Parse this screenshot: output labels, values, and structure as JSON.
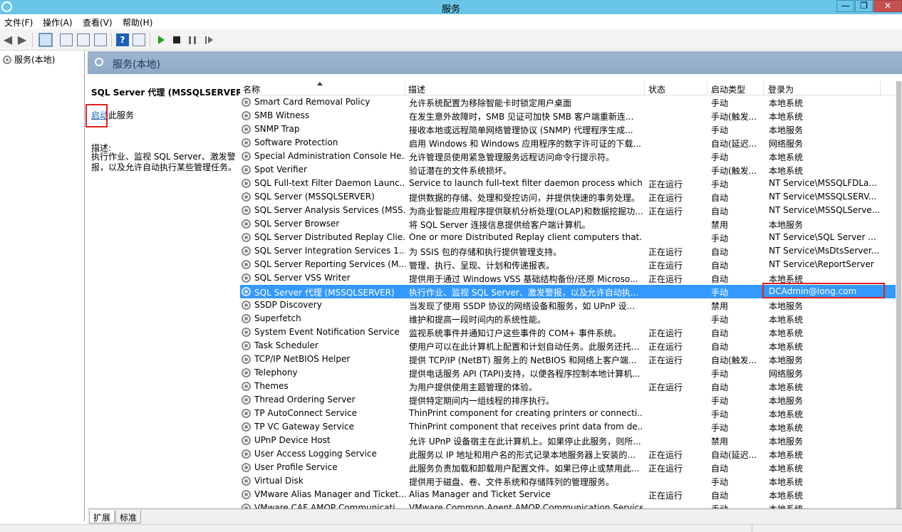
{
  "window": {
    "title": "服务"
  },
  "menu": [
    "文件(F)",
    "操作(A)",
    "查看(V)",
    "帮助(H)"
  ],
  "tree": {
    "root": "服务(本地)"
  },
  "header": {
    "title": "服务(本地)"
  },
  "detail": {
    "title": "SQL Server 代理 (MSSQLSERVER)",
    "start_link": "启动",
    "start_tail": "此服务",
    "desc_label": "描述:",
    "desc_text": "执行作业、监视 SQL Server、激发警报，以及允许自动执行某些管理任务。"
  },
  "columns": [
    "名称",
    "描述",
    "状态",
    "启动类型",
    "登录为"
  ],
  "services": [
    {
      "name": "Smart Card Removal Policy",
      "desc": "允许系统配置为移除智能卡时锁定用户桌面",
      "status": "",
      "start": "手动",
      "logon": "本地系统"
    },
    {
      "name": "SMB Witness",
      "desc": "在发生意外故障时，SMB 见证可加快 SMB 客户端重新连...",
      "status": "",
      "start": "手动(触发...",
      "logon": "本地系统"
    },
    {
      "name": "SNMP Trap",
      "desc": "接收本地或远程简单网络管理协议 (SNMP) 代理程序生成...",
      "status": "",
      "start": "手动",
      "logon": "本地服务"
    },
    {
      "name": "Software Protection",
      "desc": "启用 Windows 和 Windows 应用程序的数字许可证的下载...",
      "status": "",
      "start": "自动(延迟...",
      "logon": "网络服务"
    },
    {
      "name": "Special Administration Console He...",
      "desc": "允许管理员使用紧急管理服务远程访问命令行提示符。",
      "status": "",
      "start": "手动",
      "logon": "本地系统"
    },
    {
      "name": "Spot Verifier",
      "desc": "验证潜在的文件系统损坏。",
      "status": "",
      "start": "手动(触发...",
      "logon": "本地系统"
    },
    {
      "name": "SQL Full-text Filter Daemon Launc...",
      "desc": "Service to launch full-text filter daemon process which...",
      "status": "正在运行",
      "start": "手动",
      "logon": "NT Service\\MSSQLFDLa..."
    },
    {
      "name": "SQL Server (MSSQLSERVER)",
      "desc": "提供数据的存储、处理和受控访问，并提供快速的事务处理。",
      "status": "正在运行",
      "start": "自动",
      "logon": "NT Service\\MSSQLSERV..."
    },
    {
      "name": "SQL Server Analysis Services (MSS...",
      "desc": "为商业智能应用程序提供联机分析处理(OLAP)和数据挖掘功...",
      "status": "正在运行",
      "start": "自动",
      "logon": "NT Service\\MSSQLServe..."
    },
    {
      "name": "SQL Server Browser",
      "desc": "将 SQL Server 连接信息提供给客户端计算机。",
      "status": "",
      "start": "禁用",
      "logon": "本地服务"
    },
    {
      "name": "SQL Server Distributed Replay Clie...",
      "desc": "One or more Distributed Replay client computers that...",
      "status": "",
      "start": "手动",
      "logon": "NT Service\\SQL Server ..."
    },
    {
      "name": "SQL Server Integration Services 1...",
      "desc": "为 SSIS 包的存储和执行提供管理支持。",
      "status": "正在运行",
      "start": "自动",
      "logon": "NT Service\\MsDtsServer..."
    },
    {
      "name": "SQL Server Reporting Services (M...",
      "desc": "管理、执行、呈现、计划和传递报表。",
      "status": "正在运行",
      "start": "自动",
      "logon": "NT Service\\ReportServer"
    },
    {
      "name": "SQL Server VSS Writer",
      "desc": "提供用于通过 Windows VSS 基础结构备份/还原 Microso...",
      "status": "正在运行",
      "start": "自动",
      "logon": "本地系统"
    },
    {
      "name": "SQL Server 代理 (MSSQLSERVER)",
      "desc": "执行作业、监视 SQL Server、激发警报，以及允许自动执...",
      "status": "",
      "start": "手动",
      "logon": "DCAdmin@long.com",
      "selected": true
    },
    {
      "name": "SSDP Discovery",
      "desc": "当发现了使用 SSDP 协议的网络设备和服务，如 UPnP 设...",
      "status": "",
      "start": "禁用",
      "logon": "本地服务"
    },
    {
      "name": "Superfetch",
      "desc": "维护和提高一段时间内的系统性能。",
      "status": "",
      "start": "手动",
      "logon": "本地系统"
    },
    {
      "name": "System Event Notification Service",
      "desc": "监视系统事件并通知订户这些事件的 COM+ 事件系统。",
      "status": "正在运行",
      "start": "自动",
      "logon": "本地系统"
    },
    {
      "name": "Task Scheduler",
      "desc": "使用户可以在此计算机上配置和计划自动任务。此服务还托...",
      "status": "正在运行",
      "start": "自动",
      "logon": "本地系统"
    },
    {
      "name": "TCP/IP NetBIOS Helper",
      "desc": "提供 TCP/IP (NetBT) 服务上的 NetBIOS 和网络上客户端...",
      "status": "正在运行",
      "start": "自动(触发...",
      "logon": "本地服务"
    },
    {
      "name": "Telephony",
      "desc": "提供电话服务 API (TAPI)支持，以便各程序控制本地计算机...",
      "status": "",
      "start": "手动",
      "logon": "网络服务"
    },
    {
      "name": "Themes",
      "desc": "为用户提供使用主题管理的体验。",
      "status": "正在运行",
      "start": "自动",
      "logon": "本地系统"
    },
    {
      "name": "Thread Ordering Server",
      "desc": "提供特定期间内一组线程的排序执行。",
      "status": "",
      "start": "手动",
      "logon": "本地服务"
    },
    {
      "name": "TP AutoConnect Service",
      "desc": "ThinPrint component for creating printers or connecti...",
      "status": "",
      "start": "手动",
      "logon": "本地系统"
    },
    {
      "name": "TP VC Gateway Service",
      "desc": "ThinPrint component that receives print data from de...",
      "status": "",
      "start": "手动",
      "logon": "本地系统"
    },
    {
      "name": "UPnP Device Host",
      "desc": "允许 UPnP 设备宿主在此计算机上。如果停止此服务，则所...",
      "status": "",
      "start": "禁用",
      "logon": "本地服务"
    },
    {
      "name": "User Access Logging Service",
      "desc": "此服务以 IP 地址和用户名的形式记录本地服务器上安装的...",
      "status": "正在运行",
      "start": "自动(延迟...",
      "logon": "本地系统"
    },
    {
      "name": "User Profile Service",
      "desc": "此服务负责加载和卸载用户配置文件。如果已停止或禁用此...",
      "status": "正在运行",
      "start": "自动",
      "logon": "本地系统"
    },
    {
      "name": "Virtual Disk",
      "desc": "提供用于磁盘、卷、文件系统和存储阵列的管理服务。",
      "status": "",
      "start": "手动",
      "logon": "本地系统"
    },
    {
      "name": "VMware Alias Manager and Ticket...",
      "desc": "Alias Manager and Ticket Service",
      "status": "正在运行",
      "start": "自动",
      "logon": "本地系统"
    },
    {
      "name": "VMware CAF AMQP Communicati...",
      "desc": "VMware Common Agent AMQP Communication Service",
      "status": "",
      "start": "手动",
      "logon": "本地系统"
    }
  ],
  "tabs": [
    "扩展",
    "标准"
  ]
}
